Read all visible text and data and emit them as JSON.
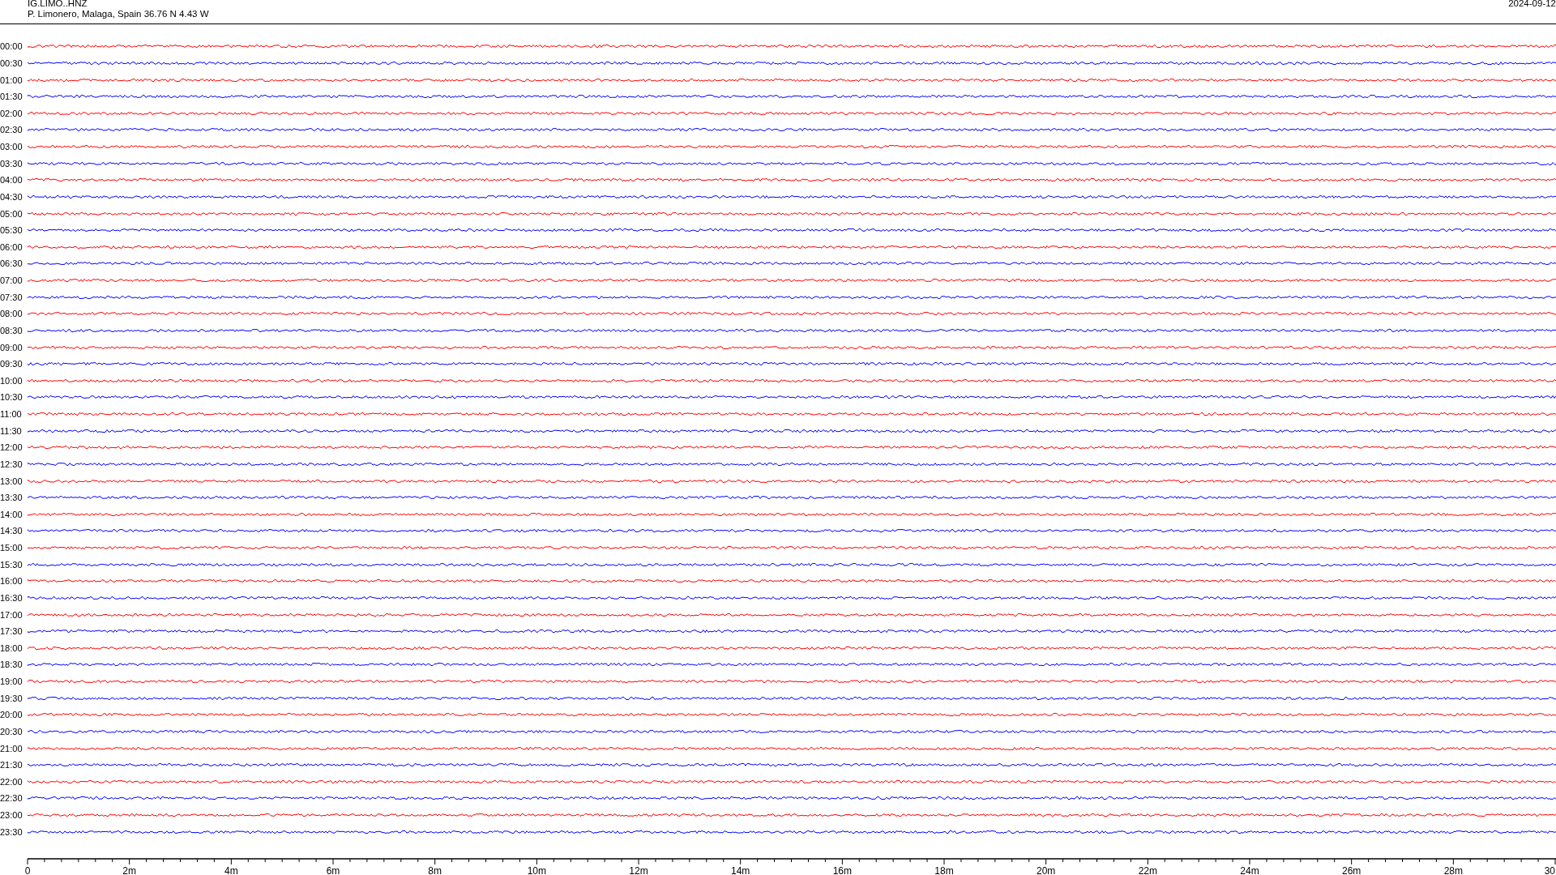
{
  "header": {
    "title": "IG.LIMO..HNZ",
    "station": "P. Limonero, Malaga, Spain  36.76 N 4.43 W",
    "date": "2024-09-12"
  },
  "rows": [
    {
      "time": "00:00",
      "color": "#ff0000"
    },
    {
      "time": "00:30",
      "color": "#0000ff"
    },
    {
      "time": "01:00",
      "color": "#ff0000"
    },
    {
      "time": "01:30",
      "color": "#0000ff"
    },
    {
      "time": "02:00",
      "color": "#ff0000"
    },
    {
      "time": "02:30",
      "color": "#0000ff"
    },
    {
      "time": "03:00",
      "color": "#ff0000"
    },
    {
      "time": "03:30",
      "color": "#0000ff"
    },
    {
      "time": "04:00",
      "color": "#ff0000"
    },
    {
      "time": "04:30",
      "color": "#0000ff"
    },
    {
      "time": "05:00",
      "color": "#ff0000"
    },
    {
      "time": "05:30",
      "color": "#0000ff"
    },
    {
      "time": "06:00",
      "color": "#ff0000"
    },
    {
      "time": "06:30",
      "color": "#0000ff"
    },
    {
      "time": "07:00",
      "color": "#ff0000"
    },
    {
      "time": "07:30",
      "color": "#0000ff"
    },
    {
      "time": "08:00",
      "color": "#ff0000"
    },
    {
      "time": "08:30",
      "color": "#0000ff"
    },
    {
      "time": "09:00",
      "color": "#ff0000"
    },
    {
      "time": "09:30",
      "color": "#0000ff"
    },
    {
      "time": "10:00",
      "color": "#ff0000"
    },
    {
      "time": "10:30",
      "color": "#0000ff"
    },
    {
      "time": "11:00",
      "color": "#ff0000"
    },
    {
      "time": "11:30",
      "color": "#0000ff"
    },
    {
      "time": "12:00",
      "color": "#ff0000"
    },
    {
      "time": "12:30",
      "color": "#0000ff"
    },
    {
      "time": "13:00",
      "color": "#ff0000"
    },
    {
      "time": "13:30",
      "color": "#0000ff"
    },
    {
      "time": "14:00",
      "color": "#ff0000"
    },
    {
      "time": "14:30",
      "color": "#0000ff"
    },
    {
      "time": "15:00",
      "color": "#ff0000"
    },
    {
      "time": "15:30",
      "color": "#0000ff"
    },
    {
      "time": "16:00",
      "color": "#ff0000"
    },
    {
      "time": "16:30",
      "color": "#0000ff"
    },
    {
      "time": "17:00",
      "color": "#ff0000"
    },
    {
      "time": "17:30",
      "color": "#0000ff"
    },
    {
      "time": "18:00",
      "color": "#ff0000"
    },
    {
      "time": "18:30",
      "color": "#0000ff"
    },
    {
      "time": "19:00",
      "color": "#ff0000"
    },
    {
      "time": "19:30",
      "color": "#0000ff"
    },
    {
      "time": "20:00",
      "color": "#ff0000"
    },
    {
      "time": "20:30",
      "color": "#0000ff"
    },
    {
      "time": "21:00",
      "color": "#ff0000"
    },
    {
      "time": "21:30",
      "color": "#0000ff"
    },
    {
      "time": "22:00",
      "color": "#ff0000"
    },
    {
      "time": "22:30",
      "color": "#0000ff"
    },
    {
      "time": "23:00",
      "color": "#ff0000"
    },
    {
      "time": "23:30",
      "color": "#0000ff"
    }
  ],
  "axis": {
    "labels": [
      "0",
      "2m",
      "4m",
      "6m",
      "8m",
      "10m",
      "12m",
      "14m",
      "16m",
      "18m",
      "20m",
      "22m",
      "24m",
      "26m",
      "28m",
      "30"
    ]
  }
}
